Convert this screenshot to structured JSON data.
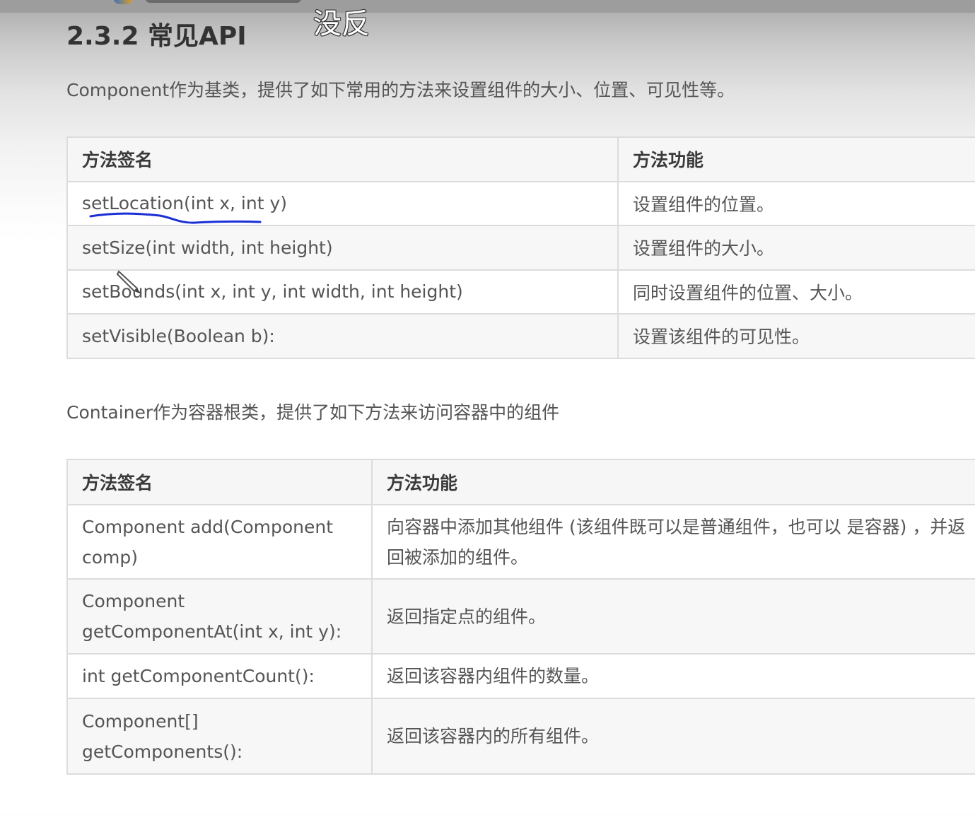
{
  "overlay": {
    "annotation": "没反"
  },
  "section": {
    "title": "2.3.2 常见API"
  },
  "component": {
    "intro": "Component作为基类，提供了如下常用的方法来设置组件的大小、位置、可见性等。",
    "headers": [
      "方法签名",
      "方法功能"
    ],
    "rows": [
      {
        "signature": "setLocation(int x, int y)",
        "function": "设置组件的位置。"
      },
      {
        "signature": "setSize(int width, int height)",
        "function": "设置组件的大小。"
      },
      {
        "signature": "setBounds(int x, int y, int width, int height)",
        "function": "同时设置组件的位置、大小。"
      },
      {
        "signature": "setVisible(Boolean b):",
        "function": "设置该组件的可见性。"
      }
    ]
  },
  "container": {
    "intro": "Container作为容器根类，提供了如下方法来访问容器中的组件",
    "headers": [
      "方法签名",
      "方法功能"
    ],
    "rows": [
      {
        "signature": "Component add(Component comp)",
        "function": "向容器中添加其他组件 (该组件既可以是普通组件，也可以 是容器) ，并返回被添加的组件。"
      },
      {
        "signature": "Component getComponentAt(int x, int y):",
        "function": "返回指定点的组件。"
      },
      {
        "signature": "int getComponentCount():",
        "function": "返回该容器内组件的数量。"
      },
      {
        "signature": "Component[] getComponents():",
        "function": "返回该容器内的所有组件。"
      }
    ]
  },
  "colors": {
    "ink_underline": "#1a2fd6",
    "table_border": "#dcdcdc",
    "text": "#555555"
  }
}
